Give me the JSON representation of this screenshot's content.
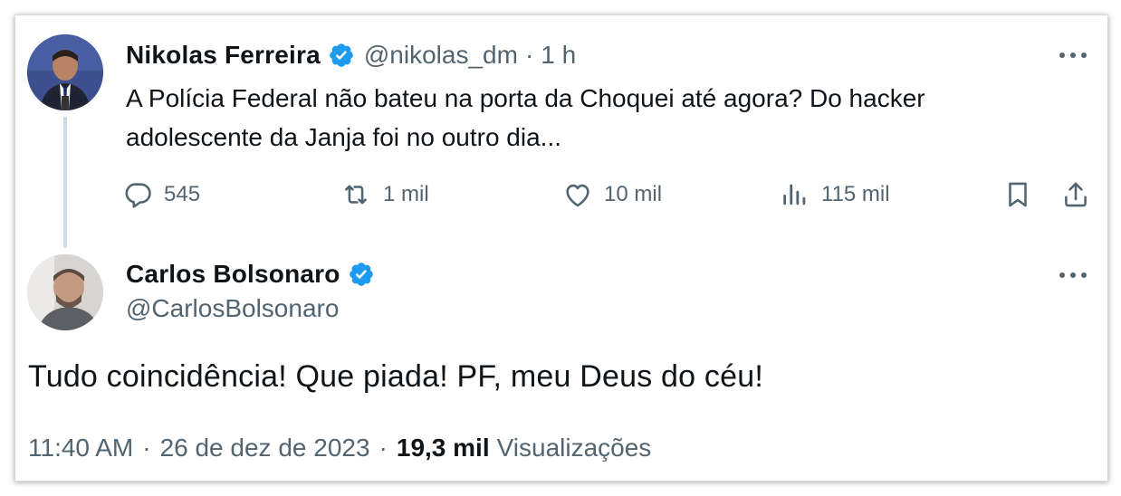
{
  "parent_tweet": {
    "author_name": "Nikolas Ferreira",
    "handle": "@nikolas_dm",
    "separator": "·",
    "time": "1 h",
    "text_line1": "A Polícia Federal não bateu na porta da Choquei até agora? Do hacker",
    "text_line2": "adolescente da Janja foi no outro dia...",
    "replies": "545",
    "retweets": "1 mil",
    "likes": "10 mil",
    "views": "115 mil",
    "icons": [
      "reply-icon",
      "retweet-icon",
      "like-icon",
      "views-icon",
      "bookmark-icon",
      "share-icon",
      "more-icon",
      "verified-icon"
    ]
  },
  "main_tweet": {
    "author_name": "Carlos Bolsonaro",
    "handle": "@CarlosBolsonaro",
    "text": "Tudo coincidência! Que piada! PF, meu Deus do céu!",
    "time": "11:40 AM",
    "separator": "·",
    "date": "26 de dez de 2023",
    "views_count": "19,3 mil",
    "views_label": "Visualizações"
  },
  "colors": {
    "verified_blue": "#1d9bf0",
    "secondary_text": "#536471",
    "primary_text": "#0f1419",
    "thread_line": "#cfd9de"
  }
}
